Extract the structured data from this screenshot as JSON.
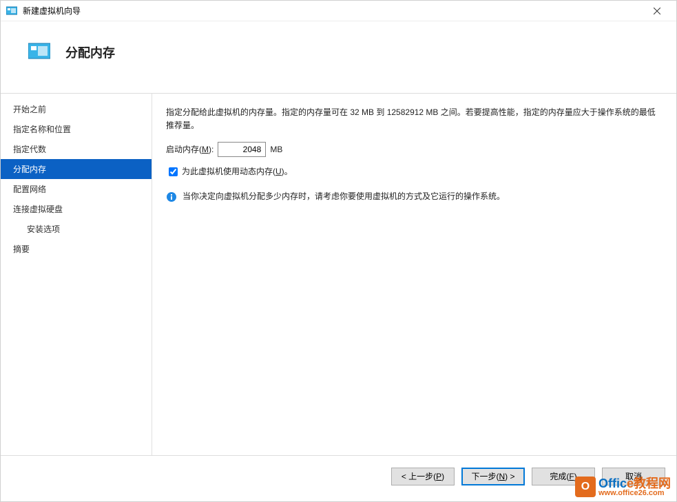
{
  "window": {
    "title": "新建虚拟机向导"
  },
  "header": {
    "page_title": "分配内存"
  },
  "sidebar": {
    "items": [
      {
        "label": "开始之前",
        "selected": false,
        "sub": false
      },
      {
        "label": "指定名称和位置",
        "selected": false,
        "sub": false
      },
      {
        "label": "指定代数",
        "selected": false,
        "sub": false
      },
      {
        "label": "分配内存",
        "selected": true,
        "sub": false
      },
      {
        "label": "配置网络",
        "selected": false,
        "sub": false
      },
      {
        "label": "连接虚拟硬盘",
        "selected": false,
        "sub": false
      },
      {
        "label": "安装选项",
        "selected": false,
        "sub": true
      },
      {
        "label": "摘要",
        "selected": false,
        "sub": false
      }
    ]
  },
  "content": {
    "desc_prefix": "指定分配给此虚拟机的内存量。指定的内存量可在 ",
    "mem_min": "32 MB",
    "desc_mid": " 到 ",
    "mem_max": "12582912 MB",
    "desc_suffix": " 之间。若要提高性能，指定的内存量应大于操作系统的最低推荐量。",
    "field_label_prefix": "启动内存(",
    "field_label_hotkey": "M",
    "field_label_suffix": "):",
    "memory_value": "2048",
    "unit": "MB",
    "checkbox_prefix": "为此虚拟机使用动态内存(",
    "checkbox_hotkey": "U",
    "checkbox_suffix": ")。",
    "checkbox_checked": true,
    "info_text": "当你决定向虚拟机分配多少内存时，请考虑你要使用虚拟机的方式及它运行的操作系统。"
  },
  "buttons": {
    "prev_prefix": "< 上一步(",
    "prev_hotkey": "P",
    "prev_suffix": ")",
    "next_prefix": "下一步(",
    "next_hotkey": "N",
    "next_suffix": ") >",
    "finish_prefix": "完成(",
    "finish_hotkey": "F",
    "finish_suffix": ")",
    "cancel": "取消"
  },
  "watermark": {
    "main1": "Offic",
    "main2": "e教程网",
    "url": "www.office26.com",
    "icon_text": "O"
  }
}
